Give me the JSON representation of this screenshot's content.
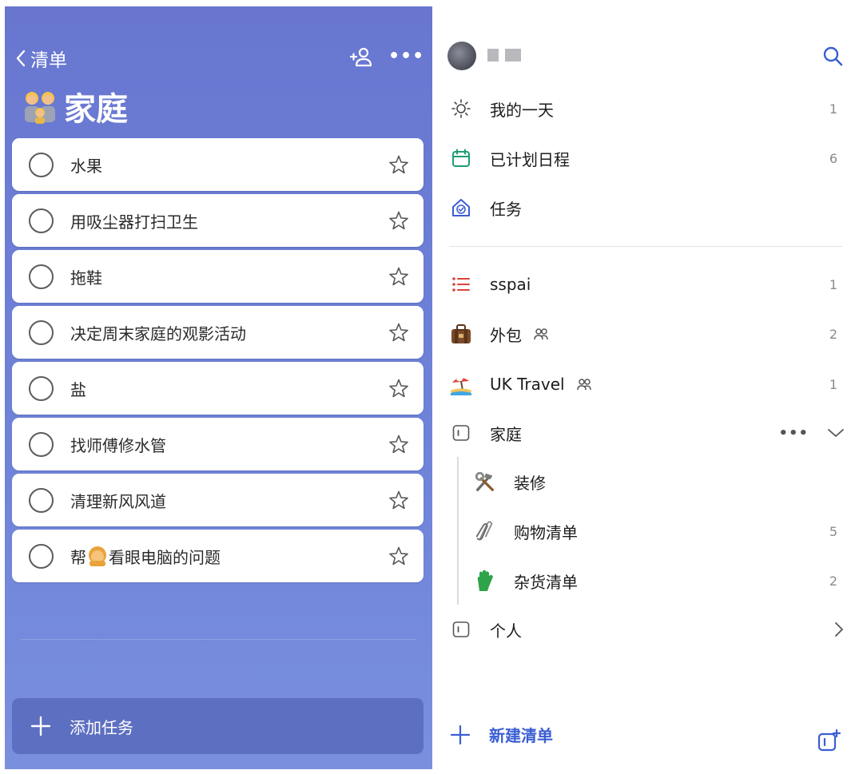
{
  "left": {
    "back_label": "清单",
    "title": "家庭",
    "tasks": [
      {
        "text": "水果"
      },
      {
        "text": "用吸尘器打扫卫生"
      },
      {
        "text": "拖鞋"
      },
      {
        "text": "决定周末家庭的观影活动"
      },
      {
        "text": "盐"
      },
      {
        "text": "找师傅修水管"
      },
      {
        "text": "清理新风风道"
      },
      {
        "text_before": "帮",
        "text_after": "看眼电脑的问题"
      }
    ],
    "add_task_label": "添加任务",
    "accent": "#6876d0"
  },
  "sidebar": {
    "smart_lists": [
      {
        "label": "我的一天",
        "count": "1",
        "icon": "sun-icon"
      },
      {
        "label": "已计划日程",
        "count": "6",
        "icon": "calendar-icon"
      },
      {
        "label": "任务",
        "count": "",
        "icon": "home-check-icon"
      }
    ],
    "lists": [
      {
        "label": "sspai",
        "count": "1",
        "icon": "list-icon"
      },
      {
        "label": "外包",
        "count": "2",
        "icon": "briefcase-icon",
        "shared": true
      },
      {
        "label": "UK Travel",
        "count": "1",
        "icon": "beach-umbrella-icon",
        "shared": true
      },
      {
        "label": "家庭",
        "icon": "group-icon"
      },
      {
        "label": "装修",
        "count": "",
        "icon": "hammer-wrench-icon"
      },
      {
        "label": "购物清单",
        "count": "5",
        "icon": "paperclip-icon"
      },
      {
        "label": "杂货清单",
        "count": "2",
        "icon": "glove-icon"
      },
      {
        "label": "个人",
        "icon": "group-icon"
      }
    ],
    "new_list_label": "新建清单",
    "accent": "#3a5ed4"
  }
}
